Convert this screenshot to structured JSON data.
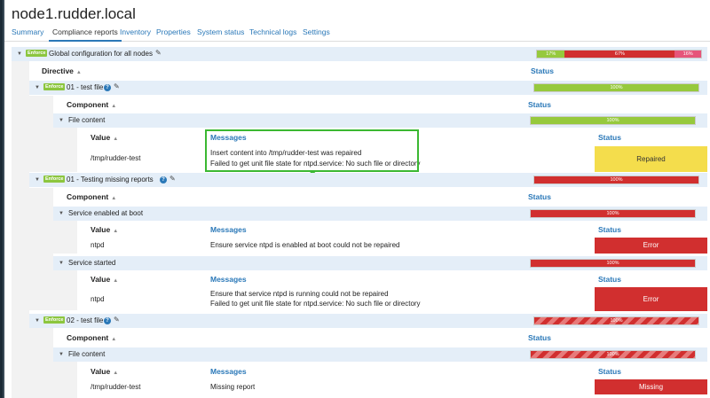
{
  "node": {
    "title": "node1.rudder.local"
  },
  "tabs": [
    "Summary",
    "Compliance reports",
    "Inventory",
    "Properties",
    "System status",
    "Technical logs",
    "Settings"
  ],
  "active_tab": "Compliance reports",
  "badge_label": "Enforce",
  "global": {
    "label": "Global configuration for all nodes",
    "compliance": {
      "green_pct": "17%",
      "red_pct": "67%",
      "pink_pct": "16%"
    }
  },
  "headers": {
    "directive": "Directive",
    "component": "Component",
    "value": "Value",
    "messages": "Messages",
    "status": "Status"
  },
  "directives": [
    {
      "name": "01 - test file",
      "compliance": "100%",
      "components": [
        {
          "name": "File content",
          "compliance": "100%",
          "values": [
            {
              "value": "/tmp/rudder-test",
              "messages": [
                "Insert content into /tmp/rudder-test was repaired",
                "Failed to get unit file state for ntpd.service: No such file or directory"
              ],
              "status": "Repaired"
            }
          ]
        }
      ]
    },
    {
      "name": "01 - Testing missing reports",
      "compliance": "100%",
      "components": [
        {
          "name": "Service enabled at boot",
          "compliance": "100%",
          "values": [
            {
              "value": "ntpd",
              "messages": [
                "Ensure service ntpd is enabled at boot  could not be repaired"
              ],
              "status": "Error"
            }
          ]
        },
        {
          "name": "Service started",
          "compliance": "100%",
          "values": [
            {
              "value": "ntpd",
              "messages": [
                "Ensure that service ntpd is running  could not be repaired",
                "Failed to get unit file state for ntpd.service: No such file or directory"
              ],
              "status": "Error"
            }
          ]
        }
      ]
    },
    {
      "name": "02 - test file",
      "compliance": "100%",
      "components": [
        {
          "name": "File content",
          "compliance": "100%",
          "values": [
            {
              "value": "/tmp/rudder-test",
              "messages": [
                "Missing report"
              ],
              "status": "Missing"
            }
          ]
        }
      ]
    }
  ],
  "annotation": {
    "text": "??????"
  },
  "colors": {
    "accent": "#2a78b8",
    "success": "#96c93d",
    "error": "#d12f2f",
    "repaired": "#f4dd4c",
    "annotation": "#3bb832"
  }
}
